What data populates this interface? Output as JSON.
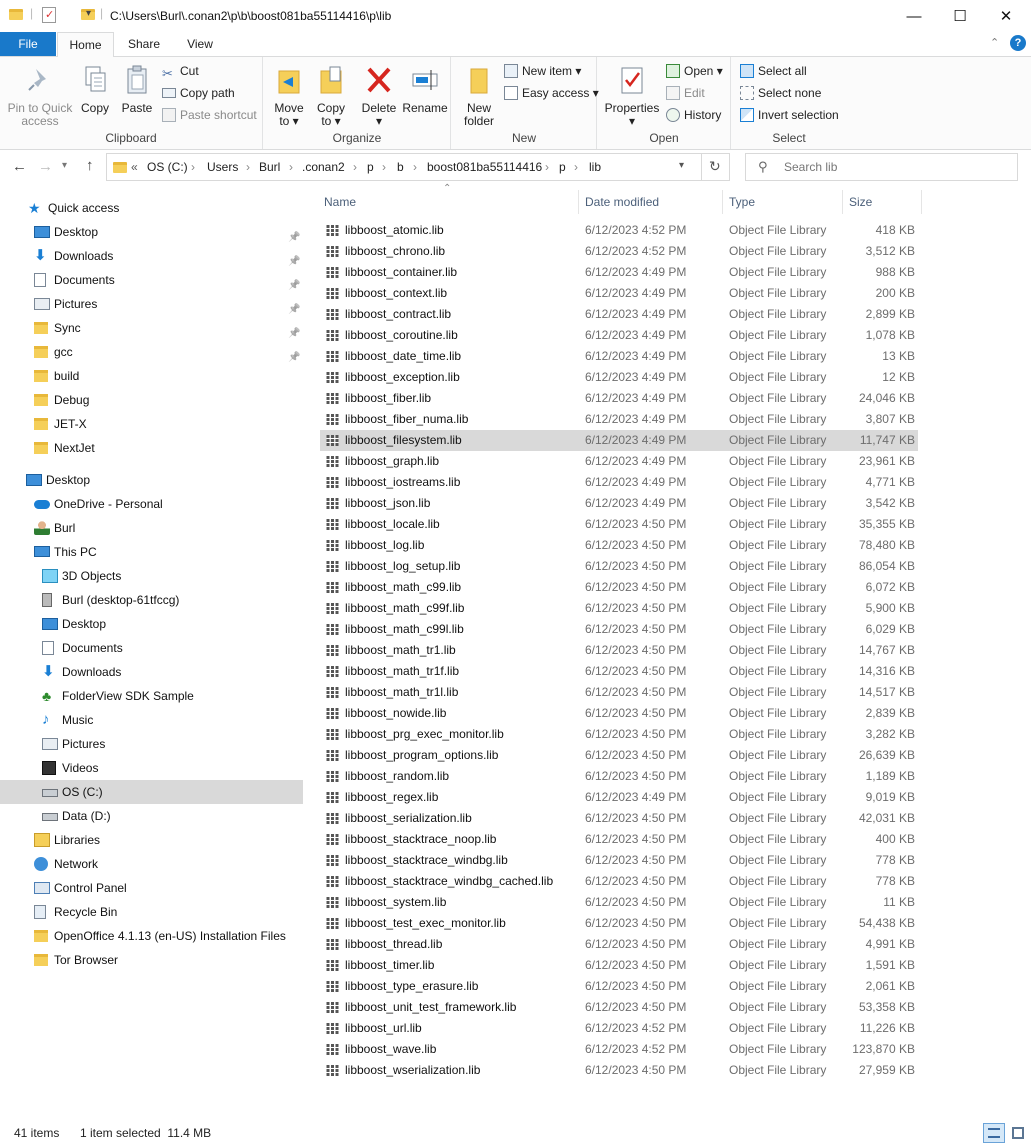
{
  "window": {
    "title_path": "C:\\Users\\Burl\\.conan2\\p\\b\\boost081ba55114416\\p\\lib",
    "controls": {
      "minimize": "—",
      "maximize": "☐",
      "close": "✕"
    }
  },
  "tabs": [
    {
      "label": "File"
    },
    {
      "label": "Home"
    },
    {
      "label": "Share"
    },
    {
      "label": "View"
    }
  ],
  "ribbon": {
    "clipboard": {
      "label": "Clipboard",
      "pin": "Pin to Quick access",
      "pin_l1": "Pin to Quick",
      "pin_l2": "access",
      "copy": "Copy",
      "paste": "Paste",
      "cut": "Cut",
      "copy_path": "Copy path",
      "paste_shortcut": "Paste shortcut"
    },
    "organize": {
      "label": "Organize",
      "move_to_l1": "Move",
      "move_to_l2": "to ▾",
      "copy_to_l1": "Copy",
      "copy_to_l2": "to ▾",
      "delete_l1": "Delete",
      "delete_l2": "▾",
      "rename": "Rename"
    },
    "new": {
      "label": "New",
      "new_folder_l1": "New",
      "new_folder_l2": "folder",
      "new_item": "New item ▾",
      "easy_access": "Easy access ▾"
    },
    "open": {
      "label": "Open",
      "properties_l1": "Properties",
      "properties_l2": "▾",
      "open": "Open ▾",
      "edit": "Edit",
      "history": "History"
    },
    "select": {
      "label": "Select",
      "select_all": "Select all",
      "select_none": "Select none",
      "invert": "Invert selection"
    }
  },
  "address": {
    "overflow": "«",
    "crumbs": [
      "OS (C:)",
      "Users",
      "Burl",
      ".conan2",
      "p",
      "b",
      "boost081ba55114416",
      "p",
      "lib"
    ],
    "search_placeholder": "Search lib"
  },
  "nav": {
    "items": [
      {
        "label": "Quick access",
        "icon": "star-icon"
      },
      {
        "label": "Desktop",
        "icon": "desktop-icon",
        "pinned": true
      },
      {
        "label": "Downloads",
        "icon": "download-icon",
        "pinned": true
      },
      {
        "label": "Documents",
        "icon": "documents-icon",
        "pinned": true
      },
      {
        "label": "Pictures",
        "icon": "pictures-icon",
        "pinned": true
      },
      {
        "label": "Sync",
        "icon": "folder-icon",
        "pinned": true
      },
      {
        "label": "gcc",
        "icon": "folder-icon",
        "pinned": true
      },
      {
        "label": "build",
        "icon": "folder-icon"
      },
      {
        "label": "Debug",
        "icon": "folder-icon"
      },
      {
        "label": "JET-X",
        "icon": "folder-icon"
      },
      {
        "label": "NextJet",
        "icon": "folder-icon"
      },
      {
        "label": "Desktop",
        "icon": "desktop-icon"
      },
      {
        "label": "OneDrive - Personal",
        "icon": "cloud-icon"
      },
      {
        "label": "Burl",
        "icon": "user-icon"
      },
      {
        "label": "This PC",
        "icon": "pc-icon"
      },
      {
        "label": "3D Objects",
        "icon": "cube-icon"
      },
      {
        "label": "Burl (desktop-61tfccg)",
        "icon": "phone-icon"
      },
      {
        "label": "Desktop",
        "icon": "desktop-icon"
      },
      {
        "label": "Documents",
        "icon": "documents-icon"
      },
      {
        "label": "Downloads",
        "icon": "download-icon"
      },
      {
        "label": "FolderView SDK Sample",
        "icon": "tree-icon"
      },
      {
        "label": "Music",
        "icon": "music-icon"
      },
      {
        "label": "Pictures",
        "icon": "pictures-icon"
      },
      {
        "label": "Videos",
        "icon": "video-icon"
      },
      {
        "label": "OS (C:)",
        "icon": "drive-icon",
        "selected": true
      },
      {
        "label": "Data (D:)",
        "icon": "drive-icon"
      },
      {
        "label": "Libraries",
        "icon": "libraries-icon"
      },
      {
        "label": "Network",
        "icon": "network-icon"
      },
      {
        "label": "Control Panel",
        "icon": "control-panel-icon"
      },
      {
        "label": "Recycle Bin",
        "icon": "recycle-bin-icon"
      },
      {
        "label": "OpenOffice 4.1.13 (en-US) Installation Files",
        "icon": "folder-icon"
      },
      {
        "label": "Tor Browser",
        "icon": "folder-icon"
      }
    ]
  },
  "columns": {
    "name": "Name",
    "date": "Date modified",
    "type": "Type",
    "size": "Size"
  },
  "files": [
    {
      "name": "libboost_atomic.lib",
      "date": "6/12/2023 4:52 PM",
      "type": "Object File Library",
      "size": "418 KB"
    },
    {
      "name": "libboost_chrono.lib",
      "date": "6/12/2023 4:52 PM",
      "type": "Object File Library",
      "size": "3,512 KB"
    },
    {
      "name": "libboost_container.lib",
      "date": "6/12/2023 4:49 PM",
      "type": "Object File Library",
      "size": "988 KB"
    },
    {
      "name": "libboost_context.lib",
      "date": "6/12/2023 4:49 PM",
      "type": "Object File Library",
      "size": "200 KB"
    },
    {
      "name": "libboost_contract.lib",
      "date": "6/12/2023 4:49 PM",
      "type": "Object File Library",
      "size": "2,899 KB"
    },
    {
      "name": "libboost_coroutine.lib",
      "date": "6/12/2023 4:49 PM",
      "type": "Object File Library",
      "size": "1,078 KB"
    },
    {
      "name": "libboost_date_time.lib",
      "date": "6/12/2023 4:49 PM",
      "type": "Object File Library",
      "size": "13 KB"
    },
    {
      "name": "libboost_exception.lib",
      "date": "6/12/2023 4:49 PM",
      "type": "Object File Library",
      "size": "12 KB"
    },
    {
      "name": "libboost_fiber.lib",
      "date": "6/12/2023 4:49 PM",
      "type": "Object File Library",
      "size": "24,046 KB"
    },
    {
      "name": "libboost_fiber_numa.lib",
      "date": "6/12/2023 4:49 PM",
      "type": "Object File Library",
      "size": "3,807 KB"
    },
    {
      "name": "libboost_filesystem.lib",
      "date": "6/12/2023 4:49 PM",
      "type": "Object File Library",
      "size": "11,747 KB",
      "selected": true
    },
    {
      "name": "libboost_graph.lib",
      "date": "6/12/2023 4:49 PM",
      "type": "Object File Library",
      "size": "23,961 KB"
    },
    {
      "name": "libboost_iostreams.lib",
      "date": "6/12/2023 4:49 PM",
      "type": "Object File Library",
      "size": "4,771 KB"
    },
    {
      "name": "libboost_json.lib",
      "date": "6/12/2023 4:49 PM",
      "type": "Object File Library",
      "size": "3,542 KB"
    },
    {
      "name": "libboost_locale.lib",
      "date": "6/12/2023 4:50 PM",
      "type": "Object File Library",
      "size": "35,355 KB"
    },
    {
      "name": "libboost_log.lib",
      "date": "6/12/2023 4:50 PM",
      "type": "Object File Library",
      "size": "78,480 KB"
    },
    {
      "name": "libboost_log_setup.lib",
      "date": "6/12/2023 4:50 PM",
      "type": "Object File Library",
      "size": "86,054 KB"
    },
    {
      "name": "libboost_math_c99.lib",
      "date": "6/12/2023 4:50 PM",
      "type": "Object File Library",
      "size": "6,072 KB"
    },
    {
      "name": "libboost_math_c99f.lib",
      "date": "6/12/2023 4:50 PM",
      "type": "Object File Library",
      "size": "5,900 KB"
    },
    {
      "name": "libboost_math_c99l.lib",
      "date": "6/12/2023 4:50 PM",
      "type": "Object File Library",
      "size": "6,029 KB"
    },
    {
      "name": "libboost_math_tr1.lib",
      "date": "6/12/2023 4:50 PM",
      "type": "Object File Library",
      "size": "14,767 KB"
    },
    {
      "name": "libboost_math_tr1f.lib",
      "date": "6/12/2023 4:50 PM",
      "type": "Object File Library",
      "size": "14,316 KB"
    },
    {
      "name": "libboost_math_tr1l.lib",
      "date": "6/12/2023 4:50 PM",
      "type": "Object File Library",
      "size": "14,517 KB"
    },
    {
      "name": "libboost_nowide.lib",
      "date": "6/12/2023 4:50 PM",
      "type": "Object File Library",
      "size": "2,839 KB"
    },
    {
      "name": "libboost_prg_exec_monitor.lib",
      "date": "6/12/2023 4:50 PM",
      "type": "Object File Library",
      "size": "3,282 KB"
    },
    {
      "name": "libboost_program_options.lib",
      "date": "6/12/2023 4:50 PM",
      "type": "Object File Library",
      "size": "26,639 KB"
    },
    {
      "name": "libboost_random.lib",
      "date": "6/12/2023 4:50 PM",
      "type": "Object File Library",
      "size": "1,189 KB"
    },
    {
      "name": "libboost_regex.lib",
      "date": "6/12/2023 4:49 PM",
      "type": "Object File Library",
      "size": "9,019 KB"
    },
    {
      "name": "libboost_serialization.lib",
      "date": "6/12/2023 4:50 PM",
      "type": "Object File Library",
      "size": "42,031 KB"
    },
    {
      "name": "libboost_stacktrace_noop.lib",
      "date": "6/12/2023 4:50 PM",
      "type": "Object File Library",
      "size": "400 KB"
    },
    {
      "name": "libboost_stacktrace_windbg.lib",
      "date": "6/12/2023 4:50 PM",
      "type": "Object File Library",
      "size": "778 KB"
    },
    {
      "name": "libboost_stacktrace_windbg_cached.lib",
      "date": "6/12/2023 4:50 PM",
      "type": "Object File Library",
      "size": "778 KB"
    },
    {
      "name": "libboost_system.lib",
      "date": "6/12/2023 4:50 PM",
      "type": "Object File Library",
      "size": "11 KB"
    },
    {
      "name": "libboost_test_exec_monitor.lib",
      "date": "6/12/2023 4:50 PM",
      "type": "Object File Library",
      "size": "54,438 KB"
    },
    {
      "name": "libboost_thread.lib",
      "date": "6/12/2023 4:50 PM",
      "type": "Object File Library",
      "size": "4,991 KB"
    },
    {
      "name": "libboost_timer.lib",
      "date": "6/12/2023 4:50 PM",
      "type": "Object File Library",
      "size": "1,591 KB"
    },
    {
      "name": "libboost_type_erasure.lib",
      "date": "6/12/2023 4:50 PM",
      "type": "Object File Library",
      "size": "2,061 KB"
    },
    {
      "name": "libboost_unit_test_framework.lib",
      "date": "6/12/2023 4:50 PM",
      "type": "Object File Library",
      "size": "53,358 KB"
    },
    {
      "name": "libboost_url.lib",
      "date": "6/12/2023 4:52 PM",
      "type": "Object File Library",
      "size": "11,226 KB"
    },
    {
      "name": "libboost_wave.lib",
      "date": "6/12/2023 4:52 PM",
      "type": "Object File Library",
      "size": "123,870 KB"
    },
    {
      "name": "libboost_wserialization.lib",
      "date": "6/12/2023 4:50 PM",
      "type": "Object File Library",
      "size": "27,959 KB"
    }
  ],
  "status": {
    "count": "41 items",
    "selection": "1 item selected  11.4 MB"
  },
  "colors": {
    "accent": "#1979ca",
    "selection": "#d9d9d9",
    "folder": "#f5cf59"
  }
}
